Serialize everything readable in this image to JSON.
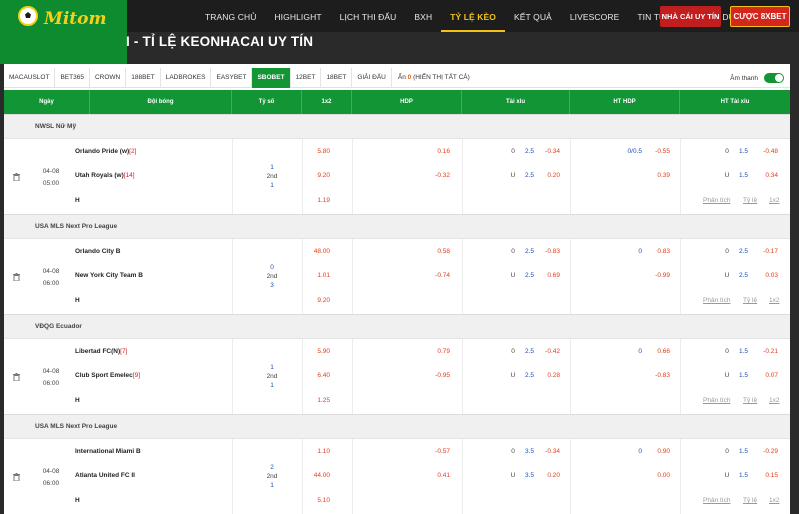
{
  "brand": {
    "logo_text": "Mitom"
  },
  "nav": [
    {
      "label": "TRANG CHỦ"
    },
    {
      "label": "HIGHLIGHT"
    },
    {
      "label": "LỊCH THI ĐẤU"
    },
    {
      "label": "BXH"
    },
    {
      "label": "TỶ LỆ KÈO"
    },
    {
      "label": "KẾT QUẢ"
    },
    {
      "label": "LIVESCORE"
    },
    {
      "label": "TIN TỨC"
    },
    {
      "label": "TUYỂN DỤNG"
    }
  ],
  "nav_active": "TỶ LỆ KÈO",
  "buttons": {
    "nhacai": "NHÀ CÁI UY TÍN",
    "cuoc": "CƯỢC 8XBET"
  },
  "page_title": "I - TỈ LỆ KEONHACAI UY TÍN",
  "bookies": [
    "MACAUSLOT",
    "BET365",
    "CROWN",
    "188BET",
    "LADBROKES",
    "EASYBET",
    "SBOBET",
    "12BET",
    "18BET",
    "GIẢI ĐẤU"
  ],
  "bookie_active": "SBOBET",
  "hidden": {
    "prefix": "Ẩn",
    "count": "0",
    "show_all": "(HIỂN THỊ TẤT CẢ)"
  },
  "sound_label": "Âm thanh",
  "columns": [
    "Ngày",
    "Đội bóng",
    "Tỷ số",
    "1x2",
    "HDP",
    "Tài xỉu",
    "HT HDP",
    "HT Tài xỉu"
  ],
  "link_labels": {
    "phan_tich": "Phân tích",
    "ty_le": "Tỷ lệ",
    "x12": "1x2"
  },
  "matches": [
    {
      "league": "NWSL Nữ Mỹ",
      "date": "04-08",
      "time": "05:00",
      "home": "Orlando Pride (w)",
      "home_rank": "[2]",
      "away": "Utah Royals (w)",
      "away_rank": "[14]",
      "draw": "H",
      "score_top": "1",
      "score_mid": "2nd",
      "score_bot": "1",
      "x12": [
        "5.80",
        "9.20",
        "1.19"
      ],
      "hdp": {
        "line1": "0.16",
        "line2": "-0.32"
      },
      "ou": {
        "r1a": "0",
        "r1b": "2.5",
        "r1c": "-0.34",
        "r2a": "U",
        "r2b": "2.5",
        "r2c": "0.20"
      },
      "hthdp": {
        "line": "0/0.5",
        "r1": "-0.55",
        "r2": "0.39"
      },
      "htou": {
        "r1a": "0",
        "r1b": "1.5",
        "r1c": "-0.48",
        "r2a": "U",
        "r2b": "1.5",
        "r2c": "0.34"
      }
    },
    {
      "league": "USA MLS Next Pro League",
      "date": "04-08",
      "time": "06:00",
      "home": "Orlando City B",
      "home_rank": "",
      "away": "New York City Team B",
      "away_rank": "",
      "draw": "H",
      "score_top": "0",
      "score_mid": "2nd",
      "score_bot": "3",
      "x12": [
        "48.00",
        "1.01",
        "9.20"
      ],
      "hdp": {
        "line1": "0.58",
        "line2": "-0.74"
      },
      "ou": {
        "r1a": "0",
        "r1b": "2.5",
        "r1c": "-0.83",
        "r2a": "U",
        "r2b": "2.5",
        "r2c": "0.69"
      },
      "hthdp": {
        "line": "0",
        "r1": "0.83",
        "r2": "-0.99"
      },
      "htou": {
        "r1a": "0",
        "r1b": "2.5",
        "r1c": "-0.17",
        "r2a": "U",
        "r2b": "2.5",
        "r2c": "0.03"
      }
    },
    {
      "league": "VĐQG Ecuador",
      "date": "04-08",
      "time": "06:00",
      "home": "Libertad FC(N)",
      "home_rank": "[7]",
      "away": "Club Sport Emelec",
      "away_rank": "[9]",
      "draw": "H",
      "score_top": "1",
      "score_mid": "2nd",
      "score_bot": "1",
      "x12": [
        "5.90",
        "6.40",
        "1.25"
      ],
      "hdp": {
        "line1": "0.79",
        "line2": "-0.95"
      },
      "ou": {
        "r1a": "0",
        "r1b": "2.5",
        "r1c": "-0.42",
        "r2a": "U",
        "r2b": "2.5",
        "r2c": "0.28"
      },
      "hthdp": {
        "line": "0",
        "r1": "0.66",
        "r2": "-0.83"
      },
      "htou": {
        "r1a": "0",
        "r1b": "1.5",
        "r1c": "-0.21",
        "r2a": "U",
        "r2b": "1.5",
        "r2c": "0.07"
      }
    },
    {
      "league": "USA MLS Next Pro League",
      "date": "04-08",
      "time": "06:00",
      "home": "International Miami B",
      "home_rank": "",
      "away": "Atlanta United FC II",
      "away_rank": "",
      "draw": "H",
      "score_top": "2",
      "score_mid": "2nd",
      "score_bot": "1",
      "x12": [
        "1.10",
        "44.00",
        "5.10"
      ],
      "hdp": {
        "line1": "-0.57",
        "line2": "0.41"
      },
      "ou": {
        "r1a": "0",
        "r1b": "3.5",
        "r1c": "-0.34",
        "r2a": "U",
        "r2b": "3.5",
        "r2c": "0.20"
      },
      "hthdp": {
        "line": "0",
        "r1": "0.90",
        "r2": "0.00"
      },
      "htou": {
        "r1a": "0",
        "r1b": "1.5",
        "r1c": "-0.29",
        "r2a": "U",
        "r2b": "1.5",
        "r2c": "0.15"
      }
    }
  ],
  "colors": {
    "brand_green": "#119535",
    "accent_yellow": "#f3c21a",
    "odds_red": "#e0401c",
    "odds_blue": "#1a4fb8"
  }
}
